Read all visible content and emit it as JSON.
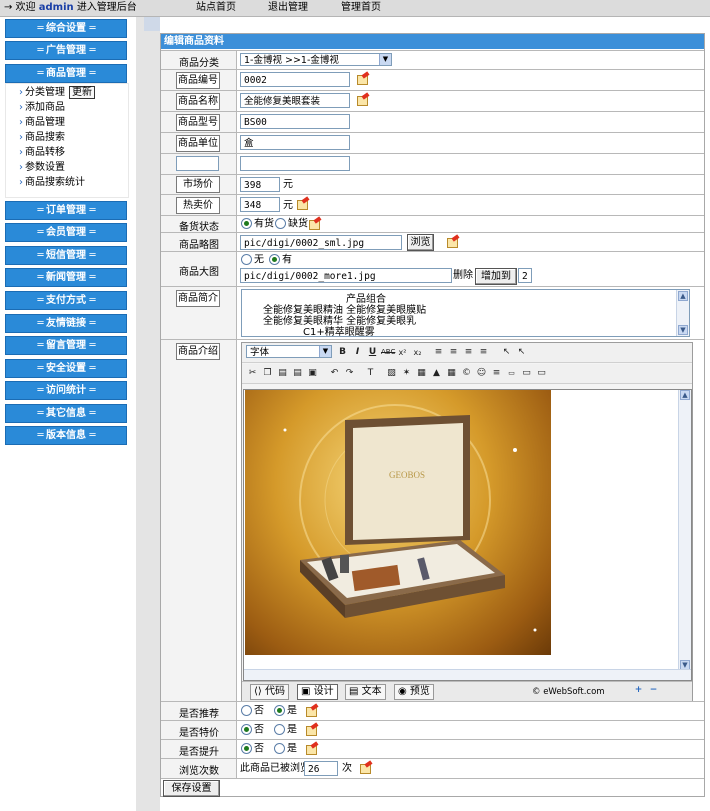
{
  "topbar": {
    "welcome_prefix": "→ 欢迎",
    "user": "admin",
    "welcome_suffix": "进入管理后台",
    "links": [
      "站点首页",
      "退出管理",
      "管理首页"
    ]
  },
  "sidebar": {
    "sections": [
      {
        "label": "综合设置",
        "key": "general"
      },
      {
        "label": "广告管理",
        "key": "ads"
      },
      {
        "label": "商品管理",
        "key": "products"
      },
      {
        "label": "订单管理",
        "key": "orders"
      },
      {
        "label": "会员管理",
        "key": "members"
      },
      {
        "label": "短信管理",
        "key": "sms"
      },
      {
        "label": "新闻管理",
        "key": "news"
      },
      {
        "label": "支付方式",
        "key": "payment"
      },
      {
        "label": "友情链接",
        "key": "links"
      },
      {
        "label": "留言管理",
        "key": "guestbook"
      },
      {
        "label": "安全设置",
        "key": "security"
      },
      {
        "label": "访问统计",
        "key": "stats"
      },
      {
        "label": "其它信息",
        "key": "other"
      },
      {
        "label": "版本信息",
        "key": "version"
      }
    ],
    "product_items": [
      {
        "label": "分类管理",
        "tag": "更新"
      },
      {
        "label": "添加商品"
      },
      {
        "label": "商品管理"
      },
      {
        "label": "商品搜索"
      },
      {
        "label": "商品转移"
      },
      {
        "label": "参数设置"
      },
      {
        "label": "商品搜索统计"
      }
    ]
  },
  "form": {
    "title": "编辑商品资料",
    "category_label": "商品分类",
    "category_value": "1-金博视 >>1-金博视",
    "code_label": "商品编号",
    "code_value": "0002",
    "name_label": "商品名称",
    "name_value": "全能修复美眼套装",
    "model_label": "商品型号",
    "model_value": "BS00",
    "unit_label": "商品单位",
    "unit_value": "盒",
    "custom_label": "",
    "custom_value": "",
    "market_price_label": "市场价",
    "market_price_value": "398",
    "price_unit": "元",
    "sale_price_label": "热卖价",
    "sale_price_value": "348",
    "stock_label": "备货状态",
    "stock_options": [
      "有货",
      "缺货"
    ],
    "stock_selected": "有货",
    "thumb_label": "商品略图",
    "thumb_value": "pic/digi/0002_sml.jpg",
    "browse_label": "浏览",
    "bigpic_label": "商品大图",
    "bigpic_options": [
      "无",
      "有"
    ],
    "bigpic_selected": "有",
    "bigpic_value": "pic/digi/0002_more1.jpg",
    "delete_label": "删除",
    "add_to_label": "增加到",
    "add_to_count": "2",
    "intro_label": "商品简介",
    "intro_lines": [
      "产品组合",
      "全能修复美眼精油   全能修复美眼膜贴",
      "全能修复美眼精华   全能修复美眼乳",
      "C1+精萃眼醒雾"
    ],
    "detail_label": "商品介绍",
    "editor": {
      "font_select": "字体",
      "brand_text": "GEOBOS",
      "modes": [
        "代码",
        "设计",
        "文本",
        "预览"
      ],
      "active_mode": "设计",
      "credit": "© eWebSoft.com"
    },
    "recommend_label": "是否推荐",
    "special_label": "是否特价",
    "promote_label": "是否提升",
    "yes_no": [
      "否",
      "是"
    ],
    "recommend_selected": "是",
    "special_selected": "否",
    "promote_selected": "否",
    "views_label": "浏览次数",
    "views_prefix": "此商品已被浏览",
    "views_value": "26",
    "views_suffix": "次",
    "save_label": "保存设置"
  }
}
